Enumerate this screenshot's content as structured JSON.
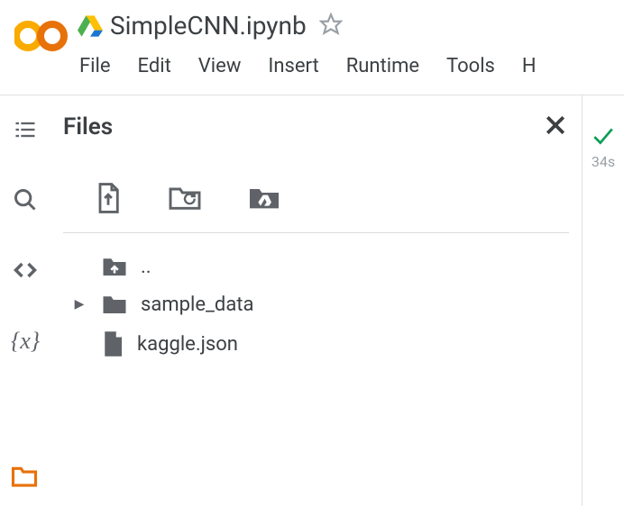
{
  "header": {
    "title": "SimpleCNN.ipynb",
    "menu": {
      "file": "File",
      "edit": "Edit",
      "view": "View",
      "insert": "Insert",
      "runtime": "Runtime",
      "tools": "Tools",
      "help": "H"
    }
  },
  "sidebar": {
    "panel_title": "Files"
  },
  "file_tree": {
    "parent": "..",
    "items": [
      {
        "name": "sample_data",
        "type": "folder"
      },
      {
        "name": "kaggle.json",
        "type": "file"
      }
    ]
  },
  "status": {
    "time": "34s"
  }
}
